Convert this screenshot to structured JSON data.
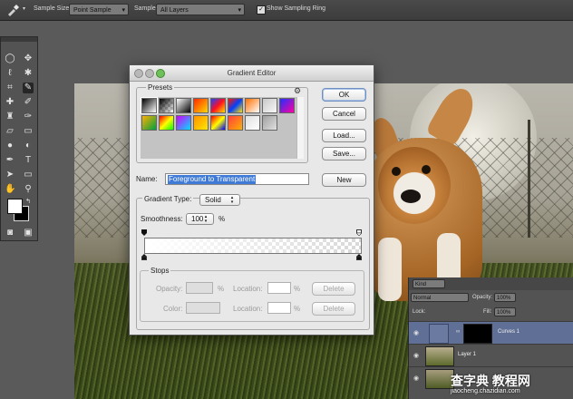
{
  "options_bar": {
    "tool_icon": "eyedropper-icon",
    "sample_size_label": "Sample Size:",
    "sample_size_value": "Point Sample",
    "sample_label": "Sample:",
    "sample_value": "All Layers",
    "show_ring_label": "Show Sampling Ring",
    "show_ring_checked": true
  },
  "gradient_editor": {
    "title": "Gradient Editor",
    "presets_label": "Presets",
    "buttons": {
      "ok": "OK",
      "cancel": "Cancel",
      "load": "Load...",
      "save": "Save...",
      "new": "New"
    },
    "name_label": "Name:",
    "name_value": "Foreground to Transparent",
    "gradient_type_label": "Gradient Type:",
    "gradient_type_value": "Solid",
    "smoothness_label": "Smoothness:",
    "smoothness_value": "100",
    "smoothness_unit": "%",
    "stops": {
      "label": "Stops",
      "opacity_label": "Opacity:",
      "color_label": "Color:",
      "location_label": "Location:",
      "percent": "%",
      "delete_label": "Delete"
    },
    "preset_swatches": [
      "#000000-#ffffff",
      "#000000-transparent",
      "#ffffff-#000000",
      "#ff2a00-#ffd800",
      "#2040ff-#ff1020-#ffe000",
      "#ff1a00-#0040ff-#ffe400",
      "#ff7000-#ffffff",
      "#c8c8c8-#f8f8f8",
      "#2030ff-#ff00a0",
      "#ffb000-#00a040",
      "#ff0000-#ffff00-#00ff00",
      "#d000ff-#00e0ff",
      "#ff9000-#ffe800",
      "#ff0000-#ffff00-#0000ff",
      "#ff4040-#ffb000",
      "#e0e0e0-#ffffff",
      "#a0a0a0-#e0e0e0"
    ]
  },
  "layers_panel": {
    "kind_label": "Kind",
    "blend_mode": "Normal",
    "opacity_label": "Opacity:",
    "opacity_value": "100%",
    "lock_label": "Lock:",
    "fill_label": "Fill:",
    "fill_value": "100%",
    "layers": [
      {
        "name": "Curves 1",
        "selected": true
      },
      {
        "name": "Layer 1",
        "selected": false
      },
      {
        "name": "",
        "selected": false
      }
    ]
  },
  "watermark": {
    "main": "查字典 教程网",
    "sub": "jiaocheng.chazidian.com"
  },
  "colors": {
    "selection": "#3f7bd6",
    "layer_selected": "#5f6f95",
    "panel": "#535353"
  }
}
